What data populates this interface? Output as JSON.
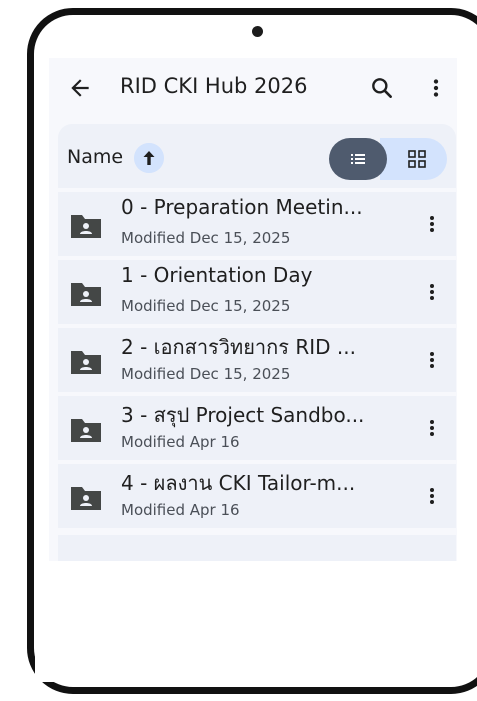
{
  "app_bar": {
    "title": "RID CKI Hub 2026",
    "back_icon": "arrow-left-icon",
    "search_icon": "search-icon",
    "more_icon": "more-vert-icon"
  },
  "sort_bar": {
    "label": "Name",
    "sort_direction": "ascending",
    "sort_icon": "arrow-up-icon",
    "view_mode": "list",
    "list_view_icon": "list-view-icon",
    "grid_view_icon": "grid-view-icon"
  },
  "files": [
    {
      "name": "0 - Preparation Meetin...",
      "modified": "Modified Dec 15, 2025",
      "icon": "shared-folder-icon"
    },
    {
      "name": "1 - Orientation Day",
      "modified": "Modified Dec 15, 2025",
      "icon": "shared-folder-icon"
    },
    {
      "name": "2 - เอกสารวิทยากร RID ...",
      "modified": "Modified Dec 15, 2025",
      "icon": "shared-folder-icon"
    },
    {
      "name": "3 - สรุป Project Sandbo...",
      "modified": "Modified Apr 16",
      "icon": "shared-folder-icon"
    },
    {
      "name": "4 - ผลงาน CKI Tailor-m...",
      "modified": "Modified Apr 16",
      "icon": "shared-folder-icon"
    }
  ],
  "colors": {
    "screen_bg": "#f7f8fc",
    "row_bg": "#eef1f8",
    "accent_light": "#d3e3fd",
    "toggle_active": "#4f5b6e",
    "text_primary": "#1f1f1f",
    "text_secondary": "#4a4f57",
    "icon": "#444746"
  }
}
